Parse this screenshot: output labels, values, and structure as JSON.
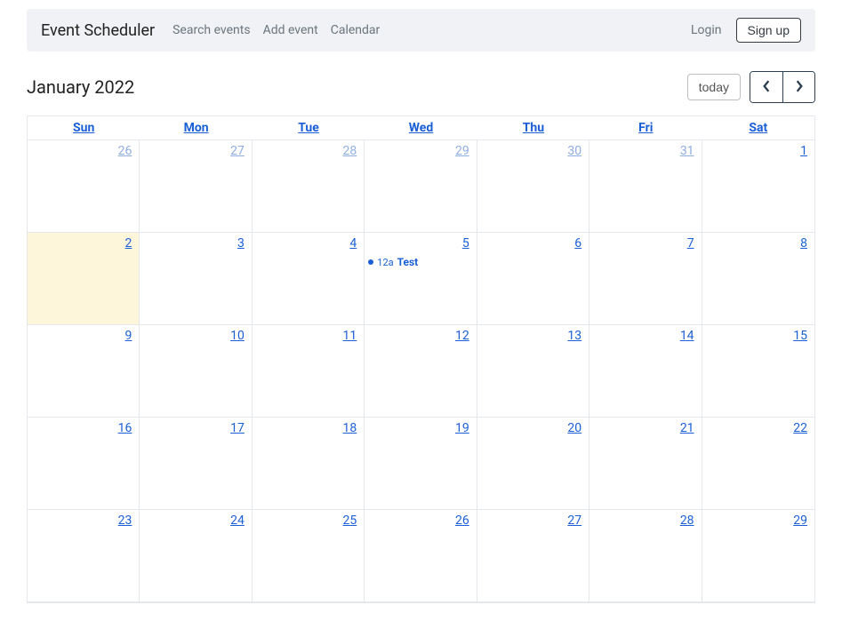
{
  "navbar": {
    "brand": "Event Scheduler",
    "links": [
      "Search events",
      "Add event",
      "Calendar"
    ],
    "login": "Login",
    "signup": "Sign up"
  },
  "toolbar": {
    "title": "January 2022",
    "today_label": "today"
  },
  "calendar": {
    "dow": [
      "Sun",
      "Mon",
      "Tue",
      "Wed",
      "Thu",
      "Fri",
      "Sat"
    ],
    "today": {
      "week": 1,
      "day": 0
    },
    "weeks": [
      [
        {
          "n": "26",
          "other": true
        },
        {
          "n": "27",
          "other": true
        },
        {
          "n": "28",
          "other": true
        },
        {
          "n": "29",
          "other": true
        },
        {
          "n": "30",
          "other": true
        },
        {
          "n": "31",
          "other": true
        },
        {
          "n": "1"
        }
      ],
      [
        {
          "n": "2"
        },
        {
          "n": "3"
        },
        {
          "n": "4"
        },
        {
          "n": "5",
          "events": [
            {
              "time": "12a",
              "title": "Test"
            }
          ]
        },
        {
          "n": "6"
        },
        {
          "n": "7"
        },
        {
          "n": "8"
        }
      ],
      [
        {
          "n": "9"
        },
        {
          "n": "10"
        },
        {
          "n": "11"
        },
        {
          "n": "12"
        },
        {
          "n": "13"
        },
        {
          "n": "14"
        },
        {
          "n": "15"
        }
      ],
      [
        {
          "n": "16"
        },
        {
          "n": "17"
        },
        {
          "n": "18"
        },
        {
          "n": "19"
        },
        {
          "n": "20"
        },
        {
          "n": "21"
        },
        {
          "n": "22"
        }
      ],
      [
        {
          "n": "23"
        },
        {
          "n": "24"
        },
        {
          "n": "25"
        },
        {
          "n": "26"
        },
        {
          "n": "27"
        },
        {
          "n": "28"
        },
        {
          "n": "29"
        }
      ]
    ]
  }
}
